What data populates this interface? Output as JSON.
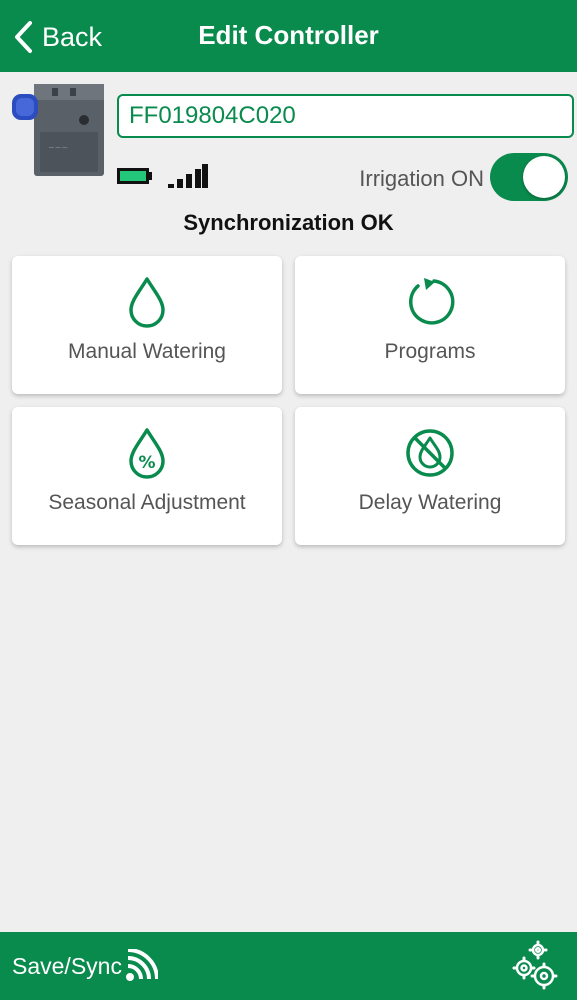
{
  "header": {
    "back_label": "Back",
    "title": "Edit Controller"
  },
  "controller": {
    "name_value": "FF019804C020",
    "irrigation_label": "Irrigation ON",
    "irrigation_on": true,
    "sync_status": "Synchronization OK",
    "battery_icon": "battery-full-icon",
    "signal_icon": "signal-strength-icon"
  },
  "tiles": [
    {
      "label": "Manual Watering",
      "icon": "water-drop-icon"
    },
    {
      "label": "Programs",
      "icon": "refresh-cycle-icon"
    },
    {
      "label": "Seasonal Adjustment",
      "icon": "percent-drop-icon"
    },
    {
      "label": "Delay Watering",
      "icon": "no-water-icon"
    }
  ],
  "footer": {
    "save_sync_label": "Save/Sync",
    "save_sync_icon": "wireless-icon",
    "settings_icon": "gears-icon"
  },
  "colors": {
    "brand_green": "#0a8b4e",
    "battery_fill": "#22c77a",
    "background": "#efefef"
  }
}
